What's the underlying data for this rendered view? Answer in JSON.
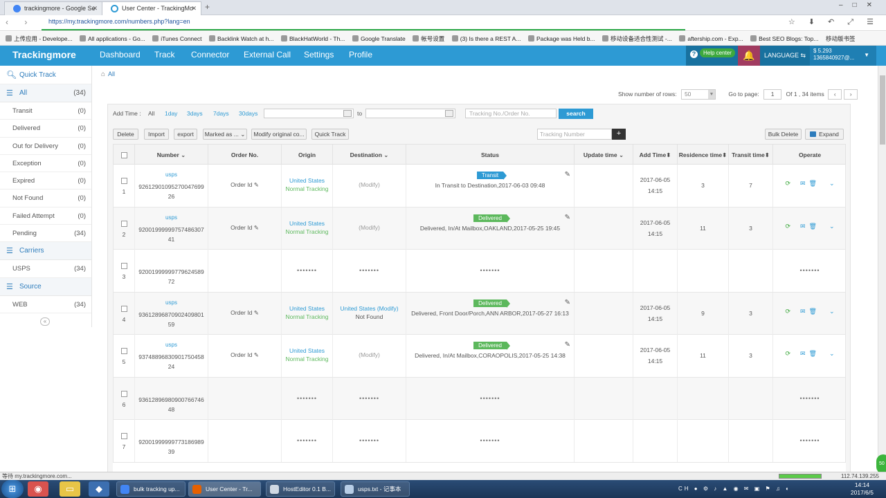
{
  "browser": {
    "tabs": [
      {
        "title": "trackingmore - Google Se",
        "icon": "google-icon",
        "active": false
      },
      {
        "title": "User Center - TrackingMo",
        "icon": "loading-icon",
        "active": true
      }
    ],
    "url": "https://my.trackingmore.com/numbers.php?lang=en",
    "bookmarks": [
      "上传应用 - Develope...",
      "All applications - Go...",
      "iTunes Connect",
      "Backlink Watch at h...",
      "BlackHatWorld - Th...",
      "Google Translate",
      "帐号设置",
      "(3) Is there a REST A...",
      "Package was Held b...",
      "移动设备适合性测试 -...",
      "aftership.com - Exp...",
      "Best SEO Blogs: Top...",
      "移动版书签"
    ]
  },
  "topnav": {
    "brand": "Trackingmore",
    "items": [
      "Dashboard",
      "Track",
      "Connector",
      "External Call",
      "Settings",
      "Profile"
    ],
    "help": "Help center",
    "language": "LANGUAGE",
    "balance": "$ 5.293",
    "account": "1365840927@..."
  },
  "sidebar": {
    "quick_track": "Quick Track",
    "all": {
      "label": "All",
      "count": "(34)"
    },
    "statuses": [
      {
        "label": "Transit",
        "count": "(0)"
      },
      {
        "label": "Delivered",
        "count": "(0)"
      },
      {
        "label": "Out for Delivery",
        "count": "(0)"
      },
      {
        "label": "Exception",
        "count": "(0)"
      },
      {
        "label": "Expired",
        "count": "(0)"
      },
      {
        "label": "Not Found",
        "count": "(0)"
      },
      {
        "label": "Failed Attempt",
        "count": "(0)"
      },
      {
        "label": "Pending",
        "count": "(34)"
      }
    ],
    "carriers_label": "Carriers",
    "carriers": [
      {
        "label": "USPS",
        "count": "(34)"
      }
    ],
    "source_label": "Source",
    "sources": [
      {
        "label": "WEB",
        "count": "(34)"
      }
    ]
  },
  "breadcrumb": "All",
  "pager": {
    "rows_label": "Show number of rows:",
    "rows_value": "50",
    "goto_label": "Go to page:",
    "page_value": "1",
    "info": "Of 1 , 34 items"
  },
  "filter": {
    "add_time_label": "Add Time :",
    "ranges": [
      "All",
      "1day",
      "3days",
      "7days",
      "30days"
    ],
    "to_label": "to",
    "search_placeholder": "Tracking No./Order No.",
    "search_button": "search"
  },
  "toolbar": {
    "delete": "Delete",
    "import": "Import",
    "export": "export",
    "marked_as": "Marked as ...",
    "modify_original": "Modify original co...",
    "quick_track": "Quick Track",
    "tracking_placeholder": "Tracking Number",
    "bulk_delete": "Bulk Delete",
    "expand": "Expand"
  },
  "table": {
    "headers": [
      "Number",
      "Order No.",
      "Origin",
      "Destination",
      "Status",
      "Update time",
      "Add Time",
      "Residence time",
      "Transit time",
      "Operate"
    ],
    "rows": [
      {
        "idx": "1",
        "carrier": "usps",
        "number1": "92612901095270047699",
        "number2": "26",
        "order": "Order Id",
        "origin1": "United States",
        "origin2": "Normal Tracking",
        "dest1": "(Modify)",
        "dest2": "",
        "badge": "Transit",
        "status": "In Transit to Destination,2017-06-03 09:48",
        "add1": "2017-06-05",
        "add2": "14:15",
        "residence": "3",
        "transit": "7",
        "type": "full"
      },
      {
        "idx": "2",
        "carrier": "usps",
        "number1": "92001999999757486307",
        "number2": "41",
        "order": "Order Id",
        "origin1": "United States",
        "origin2": "Normal Tracking",
        "dest1": "(Modify)",
        "dest2": "",
        "badge": "Delivered",
        "status": "Delivered, In/At Mailbox,OAKLAND,2017-05-25 19:45",
        "add1": "2017-06-05",
        "add2": "14:15",
        "residence": "11",
        "transit": "3",
        "type": "full"
      },
      {
        "idx": "3",
        "carrier": "",
        "number1": "92001999999779624589",
        "number2": "72",
        "type": "pending"
      },
      {
        "idx": "4",
        "carrier": "usps",
        "number1": "93612896870902409801",
        "number2": "59",
        "order": "Order Id",
        "origin1": "United States",
        "origin2": "Normal Tracking",
        "dest1": "United States (Modify)",
        "dest2": "Not Found",
        "badge": "Delivered",
        "status": "Delivered, Front Door/Porch,ANN ARBOR,2017-05-27 16:13",
        "add1": "2017-06-05",
        "add2": "14:15",
        "residence": "9",
        "transit": "3",
        "type": "full"
      },
      {
        "idx": "5",
        "carrier": "usps",
        "number1": "93748896830901750458",
        "number2": "24",
        "order": "Order Id",
        "origin1": "United States",
        "origin2": "Normal Tracking",
        "dest1": "(Modify)",
        "dest2": "",
        "badge": "Delivered",
        "status": "Delivered, In/At Mailbox,CORAOPOLIS,2017-05-25 14:38",
        "add1": "2017-06-05",
        "add2": "14:15",
        "residence": "11",
        "transit": "3",
        "type": "full"
      },
      {
        "idx": "6",
        "carrier": "",
        "number1": "93612896980900766746",
        "number2": "48",
        "type": "pending"
      },
      {
        "idx": "7",
        "carrier": "",
        "number1": "92001999999773186989",
        "number2": "39",
        "type": "pending"
      }
    ],
    "loading_dots": "•••••••"
  },
  "statusbar": {
    "text": "等待 my.trackingmore.com...",
    "ip": "112.74.139.255"
  },
  "taskbar": {
    "tasks": [
      "bulk tracking up...",
      "User Center - Tr...",
      "HostEditor 0.1 B...",
      "usps.txt - 记事本"
    ],
    "time": "14:14",
    "date": "2017/6/5"
  }
}
